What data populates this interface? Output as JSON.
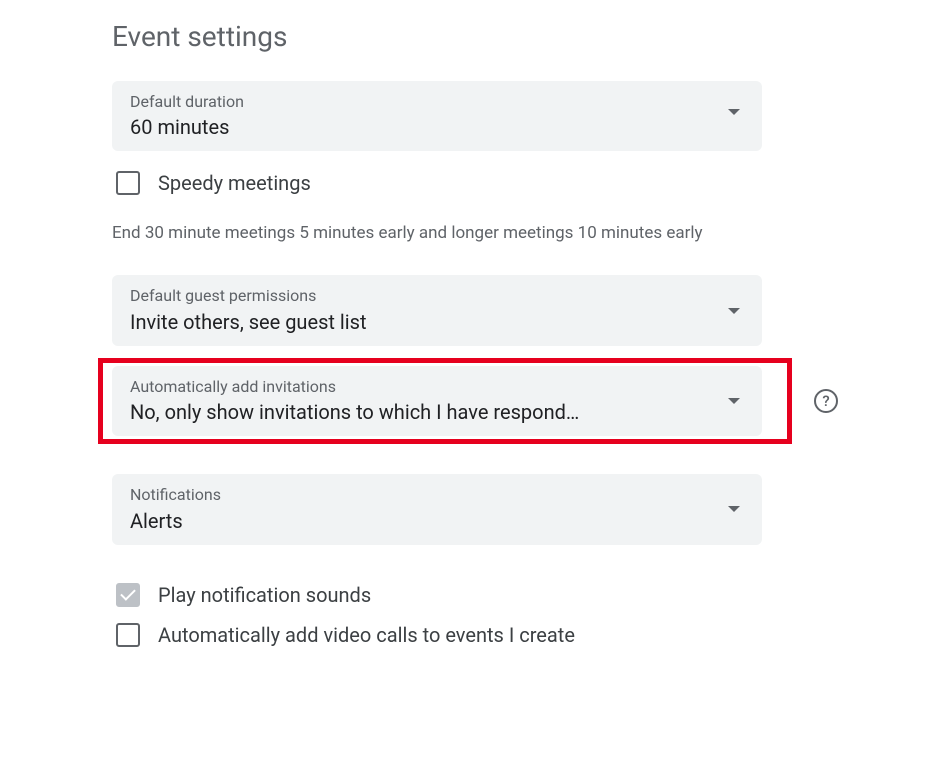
{
  "section_title": "Event settings",
  "default_duration": {
    "label": "Default duration",
    "value": "60 minutes"
  },
  "speedy_meetings": {
    "label": "Speedy meetings",
    "checked": false,
    "helper": "End 30 minute meetings 5 minutes early and longer meetings 10 minutes early"
  },
  "guest_permissions": {
    "label": "Default guest permissions",
    "value": "Invite others, see guest list"
  },
  "auto_invitations": {
    "label": "Automatically add invitations",
    "value": "No, only show invitations to which I have respond…"
  },
  "notifications": {
    "label": "Notifications",
    "value": "Alerts"
  },
  "play_sounds": {
    "label": "Play notification sounds",
    "checked": true
  },
  "auto_video": {
    "label": "Automatically add video calls to events I create",
    "checked": false
  }
}
